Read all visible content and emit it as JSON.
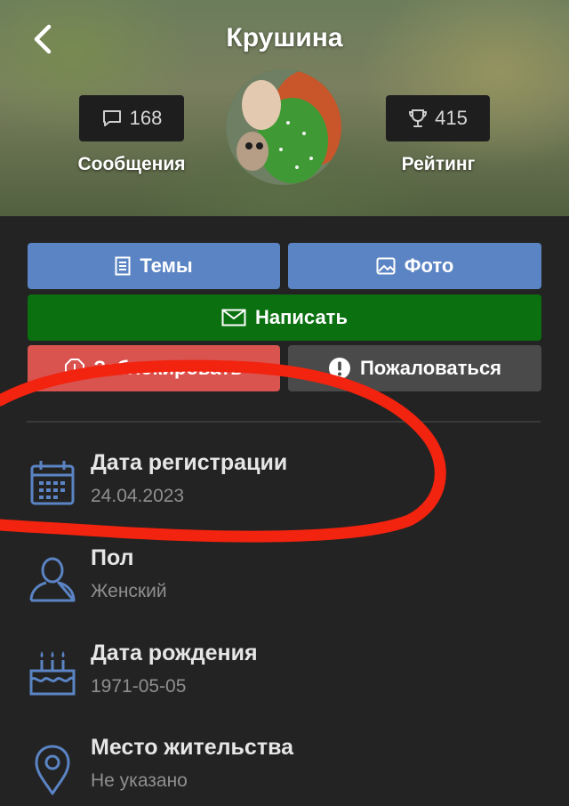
{
  "header": {
    "title": "Крушина",
    "messages_count": "168",
    "messages_label": "Сообщения",
    "rating_count": "415",
    "rating_label": "Рейтинг"
  },
  "actions": {
    "topics": "Темы",
    "photo": "Фото",
    "write": "Написать",
    "block": "Заблокировать",
    "report": "Пожаловаться"
  },
  "info": [
    {
      "label": "Дата регистрации",
      "value": "24.04.2023",
      "icon": "calendar-icon"
    },
    {
      "label": "Пол",
      "value": "Женский",
      "icon": "user-icon"
    },
    {
      "label": "Дата рождения",
      "value": "1971-05-05",
      "icon": "cake-icon"
    },
    {
      "label": "Место жительства",
      "value": "Не указано",
      "icon": "location-pin-icon"
    }
  ],
  "colors": {
    "blue_button": "#5b84c4",
    "green_button": "#0b7010",
    "red_button": "#d9534f",
    "gray_button": "#4a4a4a",
    "icon_blue": "#5b84c4",
    "annotation_red": "#f2230f",
    "background": "#232323"
  }
}
